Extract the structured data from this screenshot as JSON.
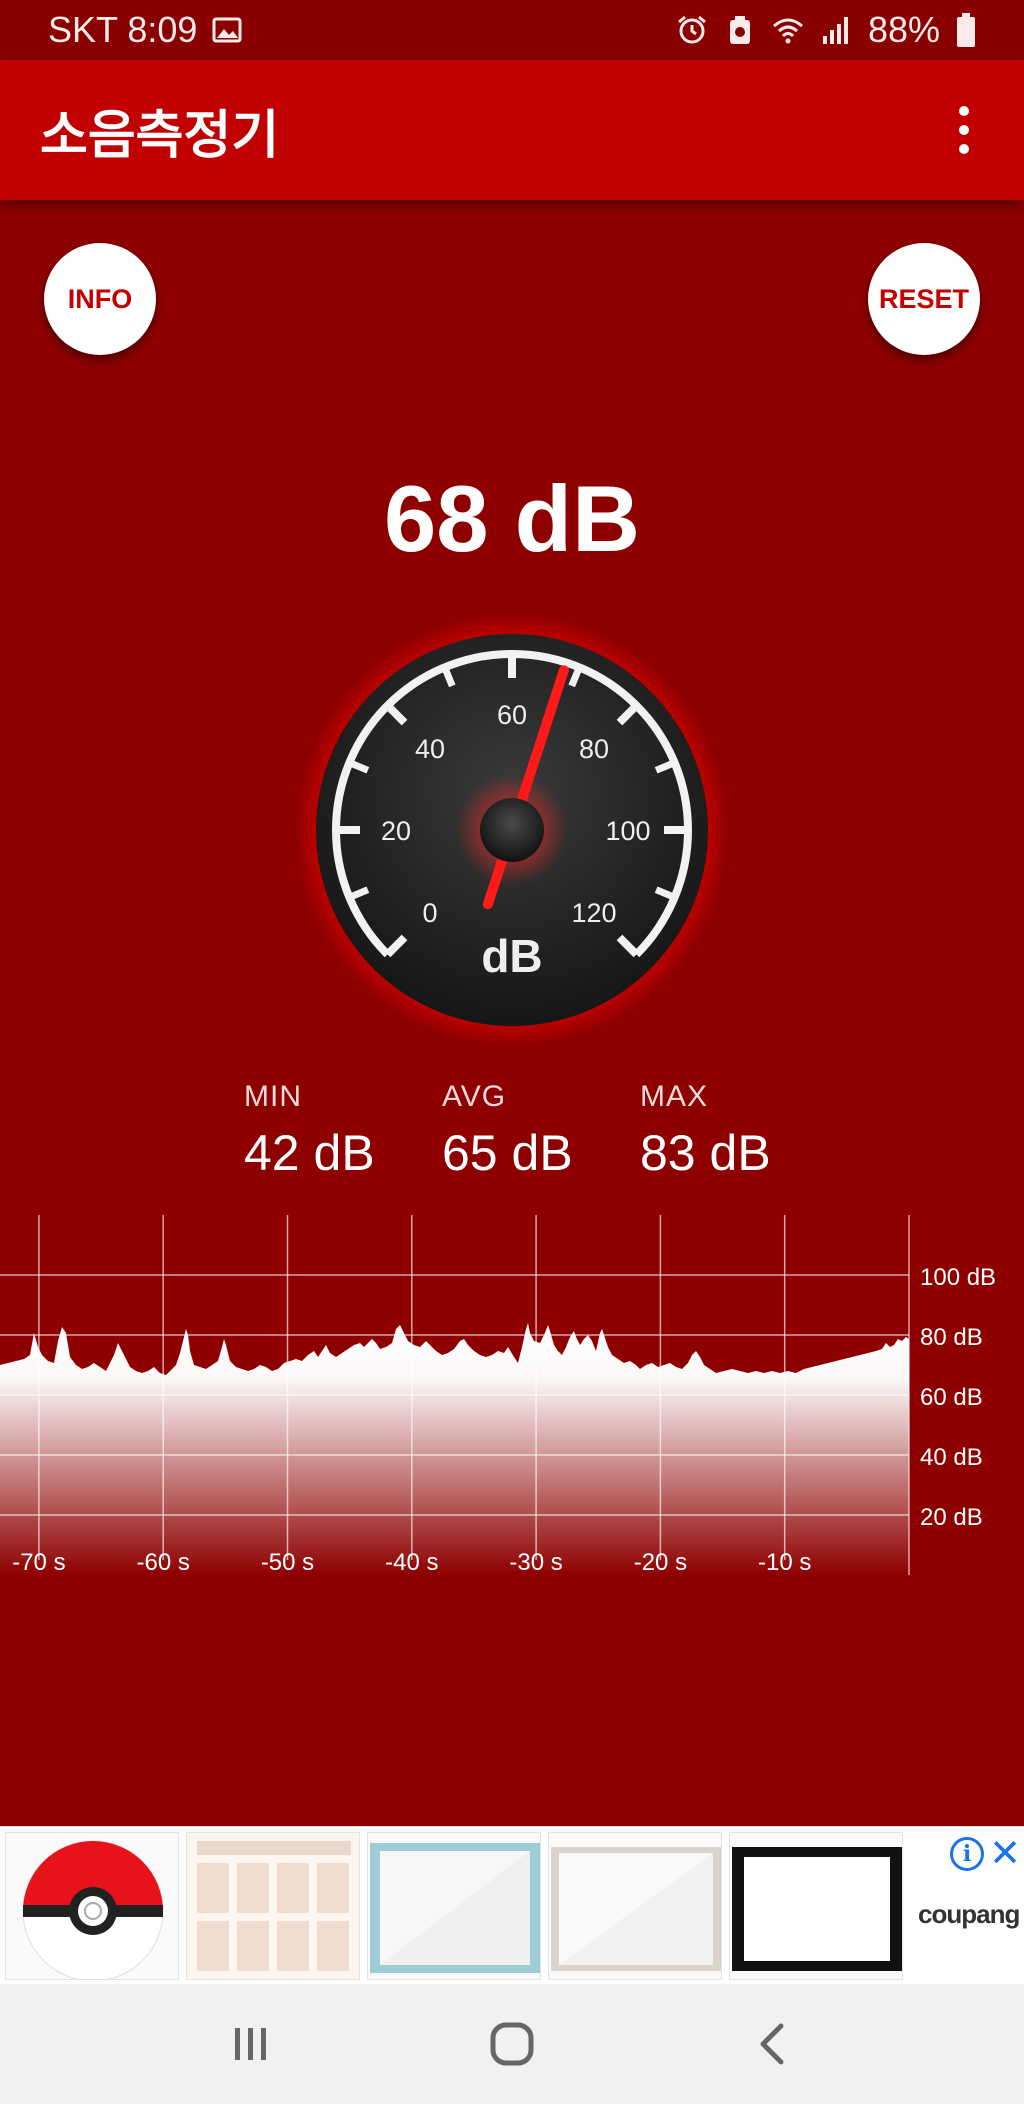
{
  "status_bar": {
    "carrier_time": "SKT 8:09",
    "battery": "88%",
    "icons": [
      "gallery-icon",
      "alarm-icon",
      "recycle-icon",
      "wifi-icon",
      "signal-icon",
      "battery-icon"
    ]
  },
  "app_bar": {
    "title": "소음측정기",
    "menu_icon": "more-vert-icon"
  },
  "controls": {
    "info_label": "INFO",
    "reset_label": "RESET"
  },
  "reading": {
    "value": "68 dB",
    "numeric": 68
  },
  "gauge": {
    "min": 0,
    "max": 120,
    "needle_value": 68,
    "tick_labels": [
      "0",
      "20",
      "40",
      "60",
      "80",
      "100",
      "120"
    ],
    "unit": "dB"
  },
  "stats": {
    "min_label": "MIN",
    "min_value": "42 dB",
    "avg_label": "AVG",
    "avg_value": "65 dB",
    "max_label": "MAX",
    "max_value": "83 dB"
  },
  "graph": {
    "y_labels": [
      "100 dB",
      "80 dB",
      "60 dB",
      "40 dB",
      "20 dB"
    ],
    "x_labels": [
      "-70 s",
      "-60 s",
      "-50 s",
      "-40 s",
      "-30 s",
      "-20 s",
      "-10 s"
    ]
  },
  "ad": {
    "brand": "coupang",
    "colors": {
      "accent": "#1a73e8"
    }
  },
  "colors": {
    "background": "#8e0000",
    "app_bar": "#c10000",
    "needle": "#ff1a1a",
    "button_text": "#c40000"
  }
}
